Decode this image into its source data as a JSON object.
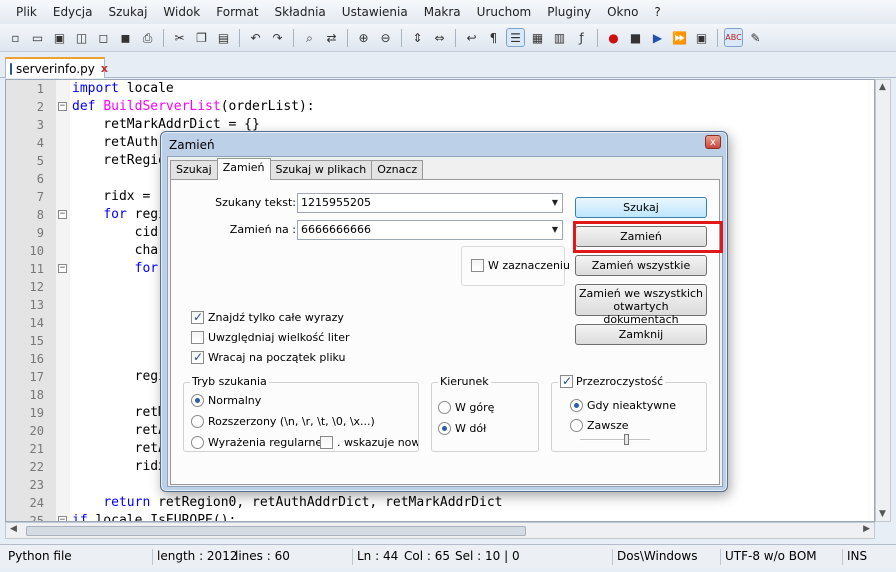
{
  "menu": [
    "Plik",
    "Edycja",
    "Szukaj",
    "Widok",
    "Format",
    "Składnia",
    "Ustawienia",
    "Makra",
    "Uruchom",
    "Pluginy",
    "Okno",
    "?"
  ],
  "toolbar": {
    "icons": [
      "new-file-icon",
      "open-file-icon",
      "save-icon",
      "save-all-icon",
      "close-file-icon",
      "close-all-icon",
      "print-icon",
      "cut-icon",
      "copy-icon",
      "paste-icon",
      "undo-icon",
      "redo-icon",
      "find-icon",
      "replace-icon",
      "zoom-in-icon",
      "zoom-out-icon",
      "sync-v-icon",
      "sync-h-icon",
      "wrap-icon",
      "all-chars-icon",
      "indent-guide-icon",
      "user-lang-icon",
      "doc-map-icon",
      "function-list-icon",
      "record-macro-icon",
      "stop-macro-icon",
      "play-macro-icon",
      "run-macro-multiple-icon",
      "save-macro-icon",
      "spell-check-icon",
      "spell-auto-icon"
    ]
  },
  "tab": {
    "filename": "serverinfo.py",
    "close": "x"
  },
  "editor": {
    "lines": [
      {
        "n": "1",
        "fold": "",
        "code": "import locale"
      },
      {
        "n": "2",
        "fold": "−",
        "code": "def BuildServerList(orderList):"
      },
      {
        "n": "3",
        "fold": "",
        "code": "    retMarkAddrDict = {}"
      },
      {
        "n": "4",
        "fold": "",
        "code": "    retAuth"
      },
      {
        "n": "5",
        "fold": "",
        "code": "    retRegio"
      },
      {
        "n": "6",
        "fold": "",
        "code": ""
      },
      {
        "n": "7",
        "fold": "",
        "code": "    ridx = "
      },
      {
        "n": "8",
        "fold": "−",
        "code": "    for regi"
      },
      {
        "n": "9",
        "fold": "",
        "code": "        cid"
      },
      {
        "n": "10",
        "fold": "",
        "code": "        char"
      },
      {
        "n": "11",
        "fold": "−",
        "code": "        for"
      },
      {
        "n": "12",
        "fold": "",
        "code": ""
      },
      {
        "n": "13",
        "fold": "",
        "code": ""
      },
      {
        "n": "14",
        "fold": "",
        "code": ""
      },
      {
        "n": "15",
        "fold": "",
        "code": ""
      },
      {
        "n": "16",
        "fold": "",
        "code": ""
      },
      {
        "n": "17",
        "fold": "",
        "code": "        regi"
      },
      {
        "n": "18",
        "fold": "",
        "code": ""
      },
      {
        "n": "19",
        "fold": "",
        "code": "        retM"
      },
      {
        "n": "20",
        "fold": "",
        "code": "        retA"
      },
      {
        "n": "21",
        "fold": "",
        "code": "        retA"
      },
      {
        "n": "22",
        "fold": "",
        "code": "        ridx"
      },
      {
        "n": "23",
        "fold": "",
        "code": ""
      },
      {
        "n": "24",
        "fold": "",
        "code": "    return retRegion0, retAuthAddrDict, retMarkAddrDict"
      },
      {
        "n": "25",
        "fold": "−",
        "code": "if locale.IsEUROPE():"
      }
    ]
  },
  "status": {
    "type": "Python file",
    "length": "length : 2012",
    "lines": "lines : 60",
    "ln": "Ln : 44",
    "col": "Col : 65",
    "sel": "Sel : 10 | 0",
    "eol": "Dos\\Windows",
    "encoding": "UTF-8 w/o BOM",
    "mode": "INS"
  },
  "dialog": {
    "title": "Zamień",
    "close": "x",
    "tabs": [
      "Szukaj",
      "Zamień",
      "Szukaj w plikach",
      "Oznacz"
    ],
    "find_label": "Szukany tekst:",
    "find_value": "1215955205",
    "replace_label": "Zamień na :",
    "replace_value": "6666666666",
    "in_selection": "W zaznaczeniu",
    "buttons": {
      "find": "Szukaj",
      "replace": "Zamień",
      "replace_all": "Zamień wszystkie",
      "replace_all_docs_1": "Zamień we wszystkich",
      "replace_all_docs_2": "otwartych dokumentach",
      "close": "Zamknij"
    },
    "options": {
      "whole_word": "Znajdź tylko całe wyrazy",
      "match_case": "Uwzględniaj wielkość liter",
      "wrap": "Wracaj na początek pliku"
    },
    "search_mode": {
      "title": "Tryb szukania",
      "normal": "Normalny",
      "extended": "Rozszerzony (\\n, \\r, \\t, \\0, \\x...)",
      "regex": "Wyrażenia regularne",
      "dot_nl": ". wskazuje nową l"
    },
    "direction": {
      "title": "Kierunek",
      "up": "W górę",
      "down": "W dół"
    },
    "transparency": {
      "title": "Przezroczystość",
      "on_lose_focus": "Gdy nieaktywne",
      "always": "Zawsze",
      "level": 0.68
    }
  },
  "colors": {
    "keyword": "#0000ff",
    "function_name": "#ff00ff",
    "highlight_box": "#e01818"
  }
}
